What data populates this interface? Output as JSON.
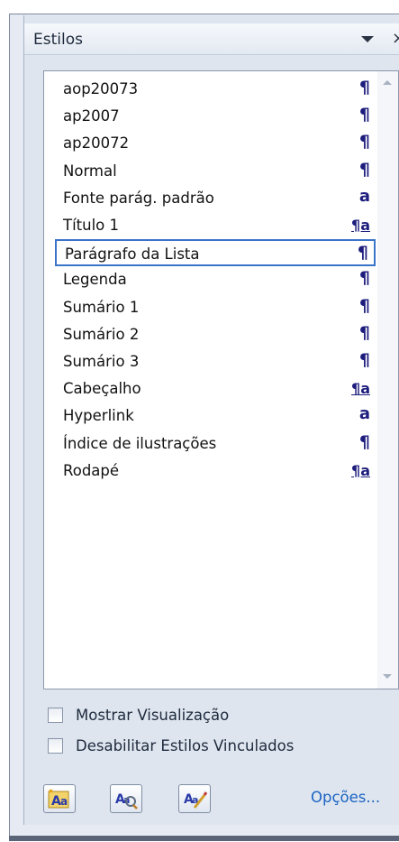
{
  "pane": {
    "title": "Estilos",
    "close_glyph": "×",
    "dropdown_icon": "chevron-down-icon"
  },
  "styles": [
    {
      "name": "aop20073",
      "type_glyph": "¶",
      "type": "paragraph"
    },
    {
      "name": "ap2007",
      "type_glyph": "¶",
      "type": "paragraph"
    },
    {
      "name": "ap20072",
      "type_glyph": "¶",
      "type": "paragraph"
    },
    {
      "name": "Normal",
      "type_glyph": "¶",
      "type": "paragraph"
    },
    {
      "name": "Fonte parág. padrão",
      "type_glyph": "a",
      "type": "character"
    },
    {
      "name": "Título 1",
      "type_glyph": "¶a",
      "type": "linked"
    },
    {
      "name": "Parágrafo da Lista",
      "type_glyph": "¶",
      "type": "paragraph",
      "selected": true
    },
    {
      "name": "Legenda",
      "type_glyph": "¶",
      "type": "paragraph"
    },
    {
      "name": "Sumário 1",
      "type_glyph": "¶",
      "type": "paragraph"
    },
    {
      "name": "Sumário 2",
      "type_glyph": "¶",
      "type": "paragraph"
    },
    {
      "name": "Sumário 3",
      "type_glyph": "¶",
      "type": "paragraph"
    },
    {
      "name": "Cabeçalho",
      "type_glyph": "¶a",
      "type": "linked"
    },
    {
      "name": "Hyperlink",
      "type_glyph": "a",
      "type": "character"
    },
    {
      "name": "Índice de ilustrações",
      "type_glyph": "¶",
      "type": "paragraph"
    },
    {
      "name": "Rodapé",
      "type_glyph": "¶a",
      "type": "linked"
    }
  ],
  "options": {
    "show_preview_label": "Mostrar Visualização",
    "show_preview_checked": false,
    "disable_linked_label": "Desabilitar Estilos Vinculados",
    "disable_linked_checked": false
  },
  "toolbar": {
    "new_style_icon": "new-style-icon",
    "style_inspector_icon": "style-inspector-icon",
    "manage_styles_icon": "manage-styles-icon",
    "options_label": "Opções..."
  },
  "colors": {
    "accent": "#3b73c9",
    "glyph": "#1d1d7d",
    "link": "#1a64c2",
    "pane_bg": "#dee5ef"
  }
}
